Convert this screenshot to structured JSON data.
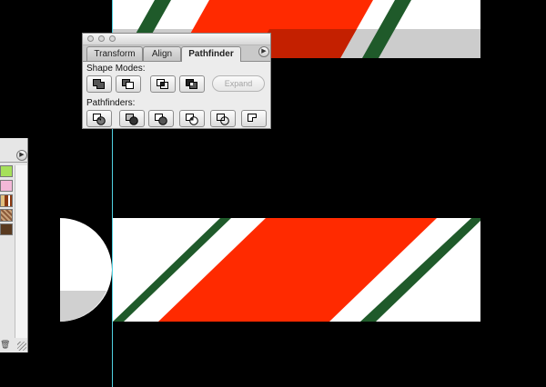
{
  "palette": {
    "tabs": [
      {
        "label": "Transform"
      },
      {
        "label": "Align"
      },
      {
        "label": "Pathfinder"
      }
    ],
    "active_tab": "Pathfinder",
    "shape_modes_label": "Shape Modes:",
    "pathfinders_label": "Pathfinders:",
    "expand_label": "Expand",
    "shape_mode_buttons": [
      "add-to-shape-area",
      "subtract-from-shape-area",
      "intersect-shape-areas",
      "exclude-overlapping-shape-areas"
    ],
    "pathfinder_buttons": [
      "divide",
      "trim",
      "merge",
      "crop",
      "outline",
      "minus-back"
    ]
  },
  "artwork": {
    "colors": {
      "red": "#ff2a00",
      "dark_red": "#c42000",
      "green": "#1f5a2a",
      "white": "#ffffff",
      "gray": "#cccccc",
      "guide": "#4fd0e0",
      "background": "#000000"
    }
  },
  "left_panel": {
    "swatch_colors": [
      "#a6e05a",
      "#f3b8d8",
      "#8b3a12",
      "#e0c080"
    ]
  }
}
